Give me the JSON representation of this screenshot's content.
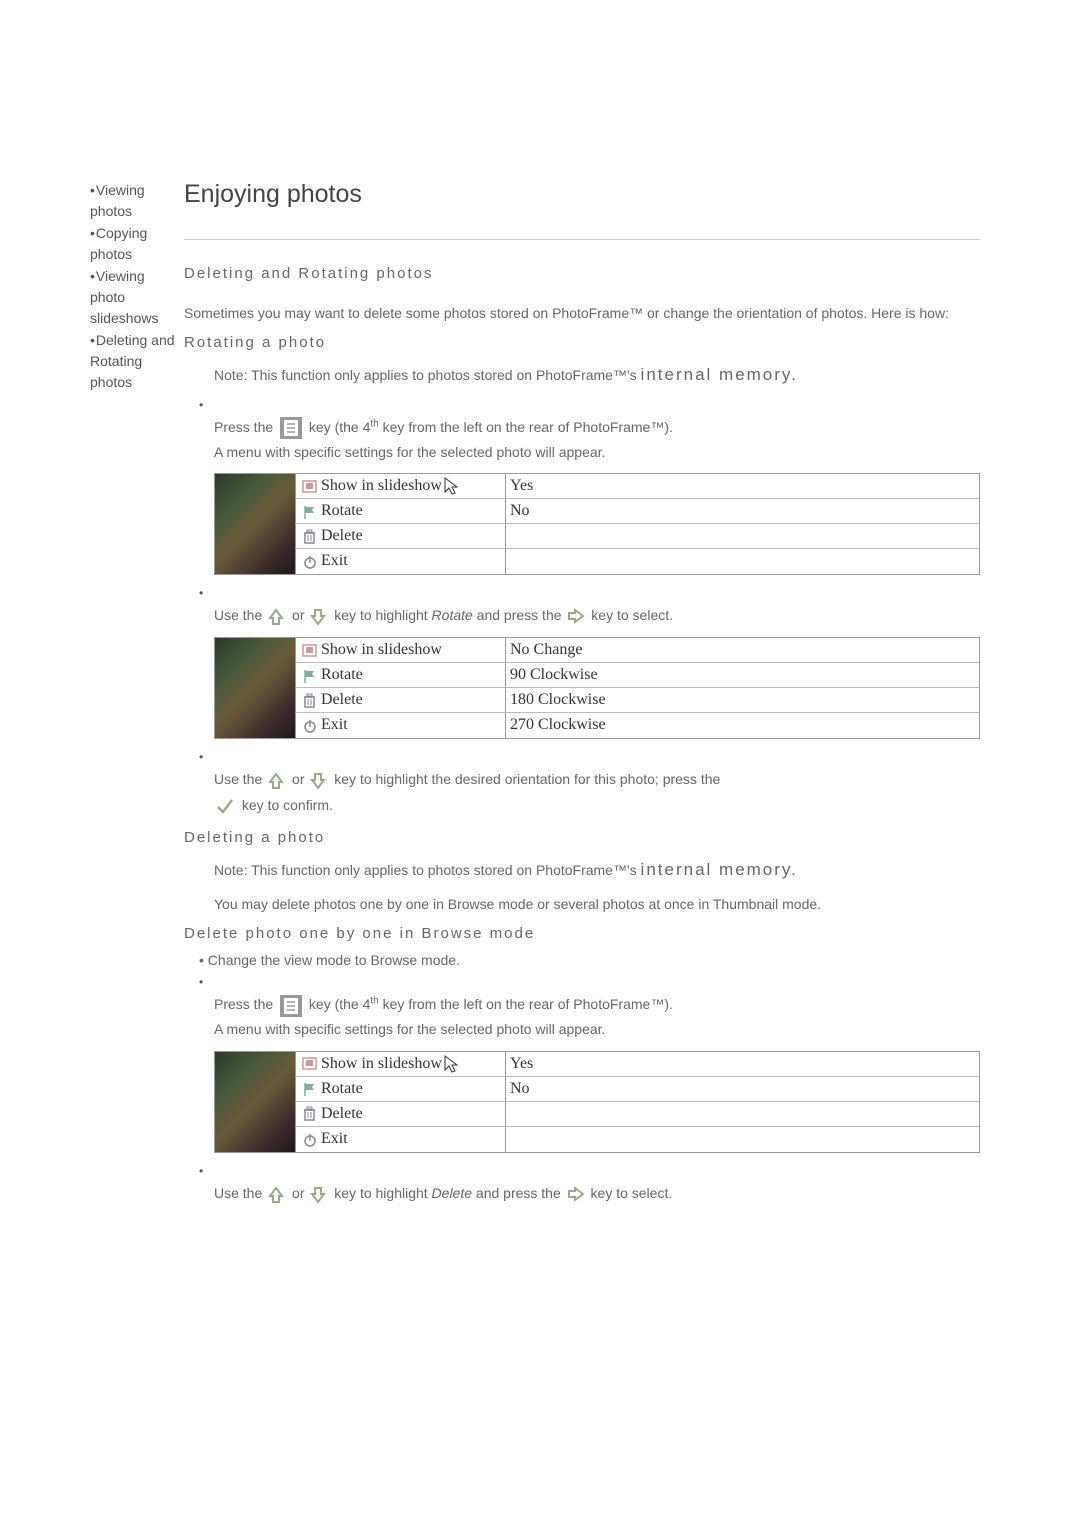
{
  "page_title": "Enjoying photos",
  "sidebar": {
    "items": [
      {
        "bullet": "•",
        "label": "Viewing photos"
      },
      {
        "bullet": "•",
        "label": "Copying photos"
      },
      {
        "bullet": "•",
        "label": "Viewing photo slideshows"
      },
      {
        "bullet": "•",
        "label": "Deleting and Rotating photos"
      }
    ]
  },
  "section1": {
    "heading": "Deleting and Rotating photos",
    "intro": "Sometimes you may want to delete some photos stored on PhotoFrame™ or change the orientation of photos. Here is how:",
    "sub_rotate": "Rotating a photo",
    "note_prefix": "Note: This function only applies to photos stored on PhotoFrame™",
    "note_suffix_s": "'s ",
    "note_suffix_mem": "internal memory.",
    "step1_a": "Press the ",
    "step1_b": " key (the 4",
    "step1_th": "th",
    "step1_c": " key from the left on the rear of PhotoFrame™).",
    "step1_d": "A menu with specific settings for the selected photo will appear.",
    "step2_a": "Use the ",
    "step2_or": " or ",
    "step2_b": " key to highlight ",
    "step2_rotate": "Rotate",
    "step2_c": " and press the ",
    "step2_d": " key to select.",
    "step3_a": "Use the ",
    "step3_or": " or ",
    "step3_b": " key to highlight the desired orientation for this photo; press the ",
    "step3_c": " key to confirm."
  },
  "menu1": {
    "rows": [
      {
        "icon": "slideshow",
        "label": "Show in slideshow",
        "right": "Yes",
        "cursor": true
      },
      {
        "icon": "flag",
        "label": "Rotate",
        "right": "No"
      },
      {
        "icon": "trash",
        "label": "Delete",
        "right": ""
      },
      {
        "icon": "power",
        "label": "Exit",
        "right": ""
      }
    ]
  },
  "menu2": {
    "rows": [
      {
        "icon": "slideshow",
        "label": "Show in slideshow",
        "right": "No Change"
      },
      {
        "icon": "flag",
        "label": "Rotate",
        "right": "90 Clockwise"
      },
      {
        "icon": "trash",
        "label": "Delete",
        "right": "180 Clockwise"
      },
      {
        "icon": "power",
        "label": "Exit",
        "right": "270 Clockwise"
      }
    ]
  },
  "section2": {
    "sub_delete": "Deleting a photo",
    "note_prefix": "Note: This function only applies to photos stored on PhotoFrame™",
    "note_suffix_s": "'s ",
    "note_suffix_mem": "internal memory.",
    "note2": "You may delete photos one by one in Browse mode or several photos at once in Thumbnail mode.",
    "sub_delete_one": "Delete photo one by one in Browse mode",
    "bullet_change_a": "• Change the view mode to ",
    "bullet_change_b": "Browse mode",
    "bullet_change_c": ".",
    "step1_a": "Press the ",
    "step1_b": " key (the 4",
    "step1_th": "th",
    "step1_c": " key from the left on the rear of PhotoFrame™).",
    "step1_d": "A menu with specific settings for the selected photo will appear.",
    "step2_a": "Use the ",
    "step2_or": " or ",
    "step2_b": " key to highlight ",
    "step2_delete": "Delete",
    "step2_c": " and press the ",
    "step2_d": " key to select."
  },
  "menu3": {
    "rows": [
      {
        "icon": "slideshow",
        "label": "Show in slideshow",
        "right": "Yes",
        "cursor": true
      },
      {
        "icon": "flag",
        "label": "Rotate",
        "right": "No"
      },
      {
        "icon": "trash",
        "label": "Delete",
        "right": ""
      },
      {
        "icon": "power",
        "label": "Exit",
        "right": ""
      }
    ]
  }
}
